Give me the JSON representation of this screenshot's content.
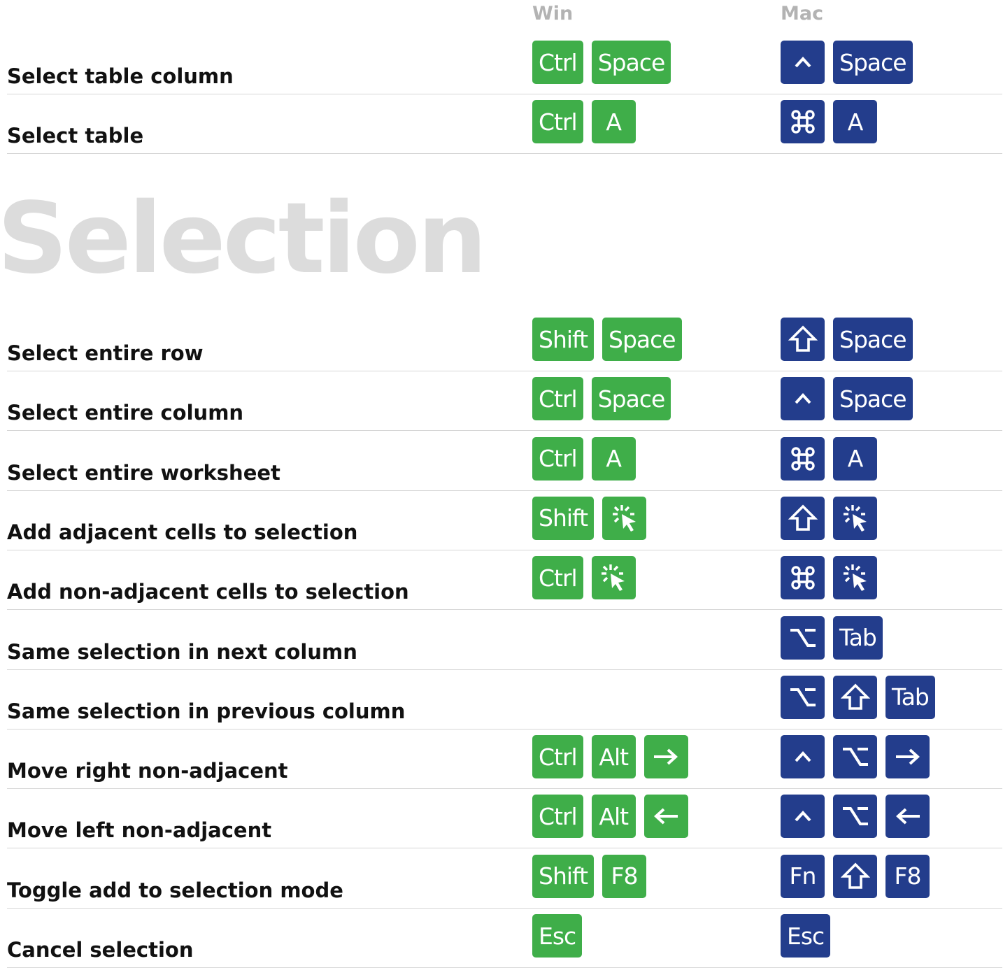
{
  "columns": {
    "win": "Win",
    "mac": "Mac"
  },
  "section_title": "Selection",
  "table_rows": [
    {
      "label": "Select table column",
      "win": [
        {
          "t": "text",
          "v": "Ctrl"
        },
        {
          "t": "text",
          "v": "Space"
        }
      ],
      "mac": [
        {
          "t": "icon",
          "v": "control-icon"
        },
        {
          "t": "text",
          "v": "Space"
        }
      ]
    },
    {
      "label": "Select table",
      "win": [
        {
          "t": "text",
          "v": "Ctrl"
        },
        {
          "t": "text",
          "v": "A"
        }
      ],
      "mac": [
        {
          "t": "icon",
          "v": "command-icon"
        },
        {
          "t": "text",
          "v": "A"
        }
      ]
    }
  ],
  "selection_rows": [
    {
      "label": "Select entire row",
      "win": [
        {
          "t": "text",
          "v": "Shift"
        },
        {
          "t": "text",
          "v": "Space"
        }
      ],
      "mac": [
        {
          "t": "icon",
          "v": "shift-icon"
        },
        {
          "t": "text",
          "v": "Space"
        }
      ]
    },
    {
      "label": "Select entire column",
      "win": [
        {
          "t": "text",
          "v": "Ctrl"
        },
        {
          "t": "text",
          "v": "Space"
        }
      ],
      "mac": [
        {
          "t": "icon",
          "v": "control-icon"
        },
        {
          "t": "text",
          "v": "Space"
        }
      ]
    },
    {
      "label": "Select entire worksheet",
      "win": [
        {
          "t": "text",
          "v": "Ctrl"
        },
        {
          "t": "text",
          "v": "A"
        }
      ],
      "mac": [
        {
          "t": "icon",
          "v": "command-icon"
        },
        {
          "t": "text",
          "v": "A"
        }
      ]
    },
    {
      "label": "Add adjacent cells to selection",
      "win": [
        {
          "t": "text",
          "v": "Shift"
        },
        {
          "t": "icon",
          "v": "click-icon"
        }
      ],
      "mac": [
        {
          "t": "icon",
          "v": "shift-icon"
        },
        {
          "t": "icon",
          "v": "click-icon"
        }
      ]
    },
    {
      "label": "Add non-adjacent cells to selection",
      "win": [
        {
          "t": "text",
          "v": "Ctrl"
        },
        {
          "t": "icon",
          "v": "click-icon"
        }
      ],
      "mac": [
        {
          "t": "icon",
          "v": "command-icon"
        },
        {
          "t": "icon",
          "v": "click-icon"
        }
      ]
    },
    {
      "label": "Same selection in next column",
      "win": [],
      "mac": [
        {
          "t": "icon",
          "v": "option-icon"
        },
        {
          "t": "text",
          "v": "Tab"
        }
      ]
    },
    {
      "label": "Same selection in previous column",
      "win": [],
      "mac": [
        {
          "t": "icon",
          "v": "option-icon"
        },
        {
          "t": "icon",
          "v": "shift-icon"
        },
        {
          "t": "text",
          "v": "Tab"
        }
      ]
    },
    {
      "label": "Move right non-adjacent",
      "win": [
        {
          "t": "text",
          "v": "Ctrl"
        },
        {
          "t": "text",
          "v": "Alt"
        },
        {
          "t": "icon",
          "v": "arrow-right-icon"
        }
      ],
      "mac": [
        {
          "t": "icon",
          "v": "control-icon"
        },
        {
          "t": "icon",
          "v": "option-icon"
        },
        {
          "t": "icon",
          "v": "arrow-right-icon"
        }
      ]
    },
    {
      "label": "Move left non-adjacent",
      "win": [
        {
          "t": "text",
          "v": "Ctrl"
        },
        {
          "t": "text",
          "v": "Alt"
        },
        {
          "t": "icon",
          "v": "arrow-left-icon"
        }
      ],
      "mac": [
        {
          "t": "icon",
          "v": "control-icon"
        },
        {
          "t": "icon",
          "v": "option-icon"
        },
        {
          "t": "icon",
          "v": "arrow-left-icon"
        }
      ]
    },
    {
      "label": "Toggle add to selection mode",
      "win": [
        {
          "t": "text",
          "v": "Shift"
        },
        {
          "t": "text",
          "v": "F8"
        }
      ],
      "mac": [
        {
          "t": "text",
          "v": "Fn"
        },
        {
          "t": "icon",
          "v": "shift-icon"
        },
        {
          "t": "text",
          "v": "F8"
        }
      ]
    },
    {
      "label": "Cancel selection",
      "win": [
        {
          "t": "text",
          "v": "Esc"
        }
      ],
      "mac": [
        {
          "t": "text",
          "v": "Esc"
        }
      ]
    }
  ],
  "colors": {
    "win_key": "#3fae49",
    "mac_key": "#233d8c",
    "title": "#dcdcdc",
    "header": "#b3b3b3"
  }
}
